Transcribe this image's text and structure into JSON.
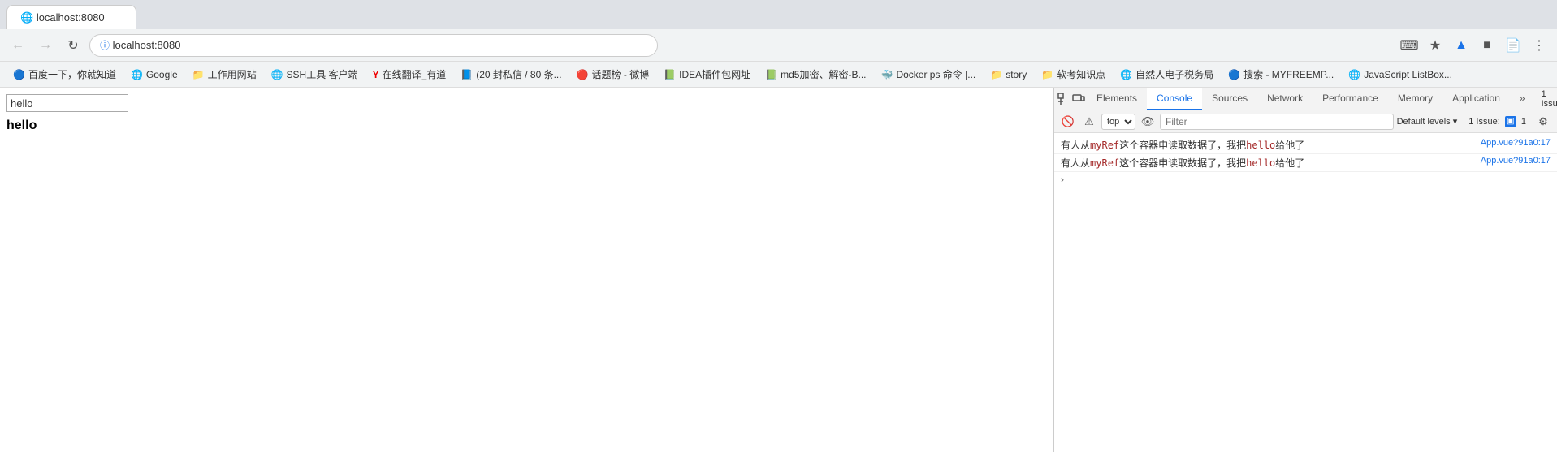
{
  "browser": {
    "tab_title": "localhost:8080",
    "address": "localhost:8080",
    "back_btn": "←",
    "forward_btn": "→",
    "reload_btn": "↻",
    "bookmarks": [
      {
        "label": "百度一下，你就知道",
        "icon": "🔵"
      },
      {
        "label": "Google",
        "icon": "🌐"
      },
      {
        "label": "工作用网站",
        "icon": "📁"
      },
      {
        "label": "SSH工具 客户端",
        "icon": "🌐"
      },
      {
        "label": "在线翻译_有道",
        "icon": "Y"
      },
      {
        "label": "(20 封私信 / 80 条...",
        "icon": "📘"
      },
      {
        "label": "话题榜 - 微博",
        "icon": "🔴"
      },
      {
        "label": "IDEA插件包网址",
        "icon": "📗"
      },
      {
        "label": "md5加密、解密-B...",
        "icon": "📗"
      },
      {
        "label": "Docker ps 命令 |...",
        "icon": "🐳"
      },
      {
        "label": "story",
        "icon": "📁"
      },
      {
        "label": "软考知识点",
        "icon": "📁"
      },
      {
        "label": "自然人电子税务局",
        "icon": "🌐"
      },
      {
        "label": "搜索 - MYFREEMP...",
        "icon": "🔵"
      },
      {
        "label": "JavaScript ListBox...",
        "icon": "🌐"
      }
    ]
  },
  "page": {
    "input_value": "hello",
    "hello_text": "hello"
  },
  "devtools": {
    "tabs": [
      "Elements",
      "Console",
      "Sources",
      "Network",
      "Performance",
      "Memory",
      "Application"
    ],
    "active_tab": "Console",
    "overflow_label": "»",
    "issue_count": "1",
    "issue_badge_text": "1 Issue: ▣ 1",
    "console": {
      "context_selector": "top",
      "filter_placeholder": "Filter",
      "default_levels_label": "Default levels ▾",
      "messages": [
        {
          "text_before": "有人从",
          "code1": "myRef",
          "text_middle": "这个容器申读取数据了，我把",
          "code2": "hello",
          "text_after": "给他了",
          "source": "App.vue?91a0:17"
        },
        {
          "text_before": "有人从",
          "code1": "myRef",
          "text_middle": "这个容器申读取数据了，我把",
          "code2": "hello",
          "text_after": "给他了",
          "source": "App.vue?91a0:17"
        }
      ],
      "prompt_chevron": ">"
    }
  }
}
